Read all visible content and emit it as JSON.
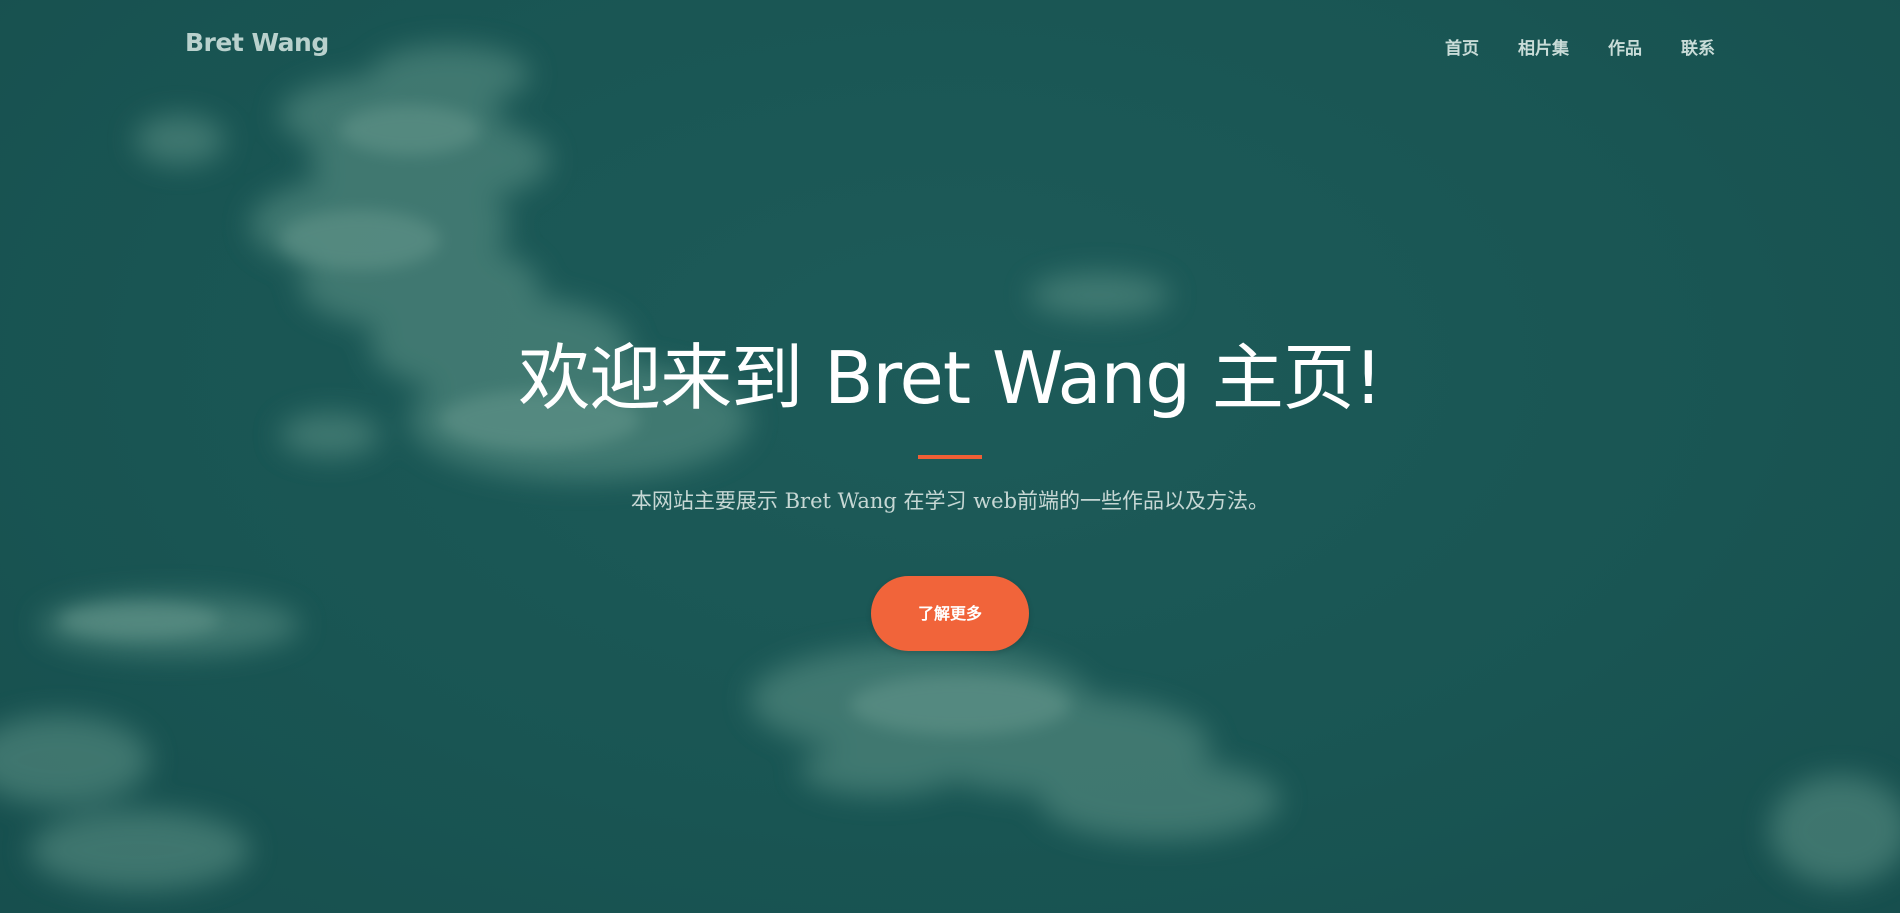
{
  "navbar": {
    "brand": "Bret Wang",
    "links": [
      {
        "label": "首页"
      },
      {
        "label": "相片集"
      },
      {
        "label": "作品"
      },
      {
        "label": "联系"
      }
    ]
  },
  "masthead": {
    "title": "欢迎来到 Bret Wang 主页!",
    "subtitle": "本网站主要展示 Bret Wang 在学习 web前端的一些作品以及方法。",
    "cta_label": "了解更多"
  },
  "colors": {
    "background": "#1c5755",
    "accent": "#f1643a",
    "text": "#ffffff",
    "nav_text": "#c9dcd8"
  }
}
